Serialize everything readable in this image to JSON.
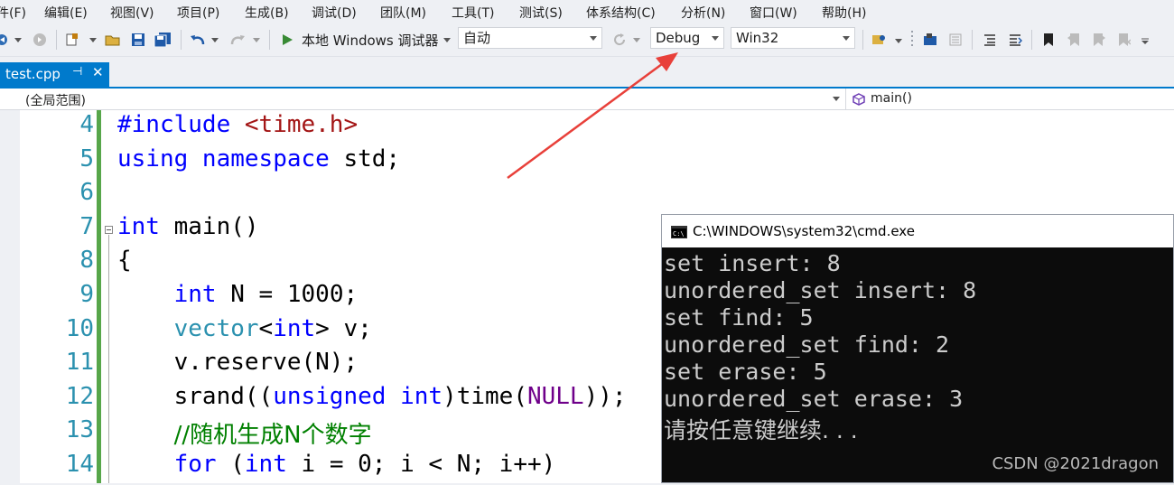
{
  "menu": [
    "件(F)",
    "编辑(E)",
    "视图(V)",
    "项目(P)",
    "生成(B)",
    "调试(D)",
    "团队(M)",
    "工具(T)",
    "测试(S)",
    "体系结构(C)",
    "分析(N)",
    "窗口(W)",
    "帮助(H)"
  ],
  "toolbar": {
    "debugger_label": "本地 Windows 调试器",
    "solution_config_auto": "自动",
    "configuration": "Debug",
    "platform": "Win32"
  },
  "tab": {
    "title": "test.cpp",
    "pin": "⊣",
    "close": "✕"
  },
  "navbar": {
    "scope": "(全局范围)",
    "function": "main()"
  },
  "editor": {
    "line_numbers": [
      "4",
      "5",
      "6",
      "7",
      "8",
      "9",
      "10",
      "11",
      "12",
      "13",
      "14"
    ],
    "lines": [
      [
        {
          "t": "#include ",
          "c": "kw"
        },
        {
          "t": "<time.h>",
          "c": "inc"
        }
      ],
      [
        {
          "t": "using ",
          "c": "kw"
        },
        {
          "t": "namespace ",
          "c": "kw"
        },
        {
          "t": "std;",
          "c": ""
        }
      ],
      [],
      [
        {
          "t": "int ",
          "c": "kw"
        },
        {
          "t": "main()",
          "c": ""
        }
      ],
      [
        {
          "t": "{",
          "c": ""
        }
      ],
      [
        {
          "t": "    ",
          "c": ""
        },
        {
          "t": "int ",
          "c": "kw"
        },
        {
          "t": "N = 1000;",
          "c": ""
        }
      ],
      [
        {
          "t": "    ",
          "c": ""
        },
        {
          "t": "vector",
          "c": "type"
        },
        {
          "t": "<",
          "c": ""
        },
        {
          "t": "int",
          "c": "kw"
        },
        {
          "t": "> v;",
          "c": ""
        }
      ],
      [
        {
          "t": "    v.reserve(N);",
          "c": ""
        }
      ],
      [
        {
          "t": "    srand((",
          "c": ""
        },
        {
          "t": "unsigned ",
          "c": "kw"
        },
        {
          "t": "int",
          "c": "kw"
        },
        {
          "t": ")time(",
          "c": ""
        },
        {
          "t": "NULL",
          "c": "mac"
        },
        {
          "t": "));",
          "c": ""
        }
      ],
      [
        {
          "t": "    ",
          "c": ""
        },
        {
          "t": "//随机生成N个数字",
          "c": "cm"
        }
      ],
      [
        {
          "t": "    ",
          "c": ""
        },
        {
          "t": "for ",
          "c": "kw"
        },
        {
          "t": "(",
          "c": ""
        },
        {
          "t": "int ",
          "c": "kw"
        },
        {
          "t": "i = 0; i < N; i++)",
          "c": ""
        }
      ]
    ]
  },
  "console": {
    "title": "C:\\WINDOWS\\system32\\cmd.exe",
    "lines": [
      "set insert: 8",
      "unordered_set insert: 8",
      "set find: 5",
      "unordered_set find: 2",
      "set erase: 5",
      "unordered_set erase: 3",
      "请按任意键继续. . ."
    ]
  },
  "watermark": "CSDN @2021dragon",
  "colors": {
    "accent": "#007acc",
    "change_bar": "#57a64a",
    "arrow": "#e8403a"
  }
}
